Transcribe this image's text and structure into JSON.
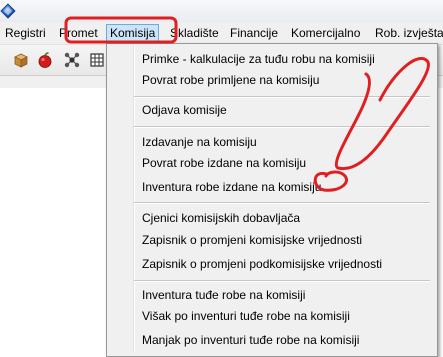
{
  "menubar": {
    "items": [
      {
        "label": "Registri"
      },
      {
        "label": "Promet"
      },
      {
        "label": "Komisija"
      },
      {
        "label": "Skladište"
      },
      {
        "label": "Financije"
      },
      {
        "label": "Komercijalno"
      },
      {
        "label": "Rob. izvještaj"
      }
    ]
  },
  "dropdown": {
    "groups": [
      [
        "Primke - kalkulacije za tuđu robu na komisiji",
        "Povrat robe primljene na komisiju"
      ],
      [
        "Odjava komisije"
      ],
      [
        "Izdavanje na komisiju",
        "Povrat robe izdane na komisiju",
        "Inventura robe izdane na komisiju"
      ],
      [
        "Cjenici komisijskih dobavljača",
        "Zapisnik o promjeni komisijske vrijednosti",
        "Zapisnik o promjeni podkomisijske vrijednosti"
      ],
      [
        "Inventura tuđe robe na komisiji",
        "Višak po inventuri tuđe robe na komisiji",
        "Manjak po inventuri tuđe robe na komisiji"
      ]
    ],
    "items": {
      "primke": "Primke - kalkulacije za tuđu robu na komisiji",
      "povrat_primljene": "Povrat robe primljene na komisiju",
      "odjava": "Odjava komisije",
      "izdavanje": "Izdavanje na komisiju",
      "povrat_izdane": "Povrat robe izdane na komisiju",
      "inventura_izdane": "Inventura robe izdane na komisiju",
      "cjenici": "Cjenici komisijskih dobavljača",
      "zapisnik_komisijske": "Zapisnik o promjeni komisijske vrijednosti",
      "zapisnik_podkomisijske": "Zapisnik o promjeni podkomisijske vrijednosti",
      "inventura_tudje": "Inventura tuđe robe na komisiji",
      "visak": "Višak po inventuri tuđe robe na komisiji",
      "manjak": "Manjak po inventuri tuđe robe na komisiji"
    }
  },
  "icons": [
    "app-logo-icon",
    "package-icon",
    "apple-icon",
    "network-icon",
    "grid-icon"
  ],
  "colors": {
    "annotation_red": "#e02020",
    "active_menu_bg": "#cce4f7",
    "active_menu_border": "#6fa8dc"
  }
}
